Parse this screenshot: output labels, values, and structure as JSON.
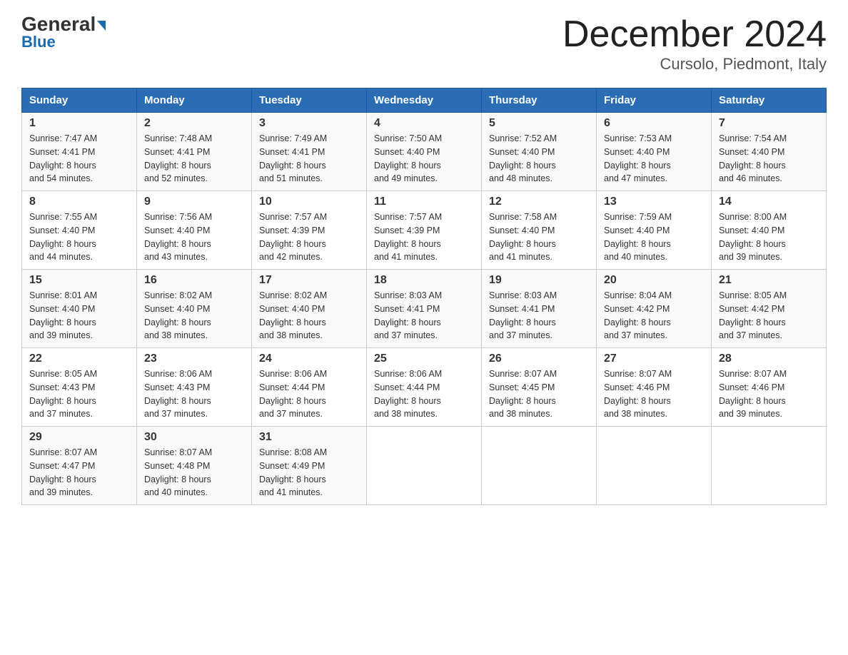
{
  "header": {
    "logo_general": "General",
    "logo_blue": "Blue",
    "title": "December 2024",
    "subtitle": "Cursolo, Piedmont, Italy"
  },
  "days_of_week": [
    "Sunday",
    "Monday",
    "Tuesday",
    "Wednesday",
    "Thursday",
    "Friday",
    "Saturday"
  ],
  "weeks": [
    [
      {
        "day": "1",
        "info": "Sunrise: 7:47 AM\nSunset: 4:41 PM\nDaylight: 8 hours\nand 54 minutes."
      },
      {
        "day": "2",
        "info": "Sunrise: 7:48 AM\nSunset: 4:41 PM\nDaylight: 8 hours\nand 52 minutes."
      },
      {
        "day": "3",
        "info": "Sunrise: 7:49 AM\nSunset: 4:41 PM\nDaylight: 8 hours\nand 51 minutes."
      },
      {
        "day": "4",
        "info": "Sunrise: 7:50 AM\nSunset: 4:40 PM\nDaylight: 8 hours\nand 49 minutes."
      },
      {
        "day": "5",
        "info": "Sunrise: 7:52 AM\nSunset: 4:40 PM\nDaylight: 8 hours\nand 48 minutes."
      },
      {
        "day": "6",
        "info": "Sunrise: 7:53 AM\nSunset: 4:40 PM\nDaylight: 8 hours\nand 47 minutes."
      },
      {
        "day": "7",
        "info": "Sunrise: 7:54 AM\nSunset: 4:40 PM\nDaylight: 8 hours\nand 46 minutes."
      }
    ],
    [
      {
        "day": "8",
        "info": "Sunrise: 7:55 AM\nSunset: 4:40 PM\nDaylight: 8 hours\nand 44 minutes."
      },
      {
        "day": "9",
        "info": "Sunrise: 7:56 AM\nSunset: 4:40 PM\nDaylight: 8 hours\nand 43 minutes."
      },
      {
        "day": "10",
        "info": "Sunrise: 7:57 AM\nSunset: 4:39 PM\nDaylight: 8 hours\nand 42 minutes."
      },
      {
        "day": "11",
        "info": "Sunrise: 7:57 AM\nSunset: 4:39 PM\nDaylight: 8 hours\nand 41 minutes."
      },
      {
        "day": "12",
        "info": "Sunrise: 7:58 AM\nSunset: 4:40 PM\nDaylight: 8 hours\nand 41 minutes."
      },
      {
        "day": "13",
        "info": "Sunrise: 7:59 AM\nSunset: 4:40 PM\nDaylight: 8 hours\nand 40 minutes."
      },
      {
        "day": "14",
        "info": "Sunrise: 8:00 AM\nSunset: 4:40 PM\nDaylight: 8 hours\nand 39 minutes."
      }
    ],
    [
      {
        "day": "15",
        "info": "Sunrise: 8:01 AM\nSunset: 4:40 PM\nDaylight: 8 hours\nand 39 minutes."
      },
      {
        "day": "16",
        "info": "Sunrise: 8:02 AM\nSunset: 4:40 PM\nDaylight: 8 hours\nand 38 minutes."
      },
      {
        "day": "17",
        "info": "Sunrise: 8:02 AM\nSunset: 4:40 PM\nDaylight: 8 hours\nand 38 minutes."
      },
      {
        "day": "18",
        "info": "Sunrise: 8:03 AM\nSunset: 4:41 PM\nDaylight: 8 hours\nand 37 minutes."
      },
      {
        "day": "19",
        "info": "Sunrise: 8:03 AM\nSunset: 4:41 PM\nDaylight: 8 hours\nand 37 minutes."
      },
      {
        "day": "20",
        "info": "Sunrise: 8:04 AM\nSunset: 4:42 PM\nDaylight: 8 hours\nand 37 minutes."
      },
      {
        "day": "21",
        "info": "Sunrise: 8:05 AM\nSunset: 4:42 PM\nDaylight: 8 hours\nand 37 minutes."
      }
    ],
    [
      {
        "day": "22",
        "info": "Sunrise: 8:05 AM\nSunset: 4:43 PM\nDaylight: 8 hours\nand 37 minutes."
      },
      {
        "day": "23",
        "info": "Sunrise: 8:06 AM\nSunset: 4:43 PM\nDaylight: 8 hours\nand 37 minutes."
      },
      {
        "day": "24",
        "info": "Sunrise: 8:06 AM\nSunset: 4:44 PM\nDaylight: 8 hours\nand 37 minutes."
      },
      {
        "day": "25",
        "info": "Sunrise: 8:06 AM\nSunset: 4:44 PM\nDaylight: 8 hours\nand 38 minutes."
      },
      {
        "day": "26",
        "info": "Sunrise: 8:07 AM\nSunset: 4:45 PM\nDaylight: 8 hours\nand 38 minutes."
      },
      {
        "day": "27",
        "info": "Sunrise: 8:07 AM\nSunset: 4:46 PM\nDaylight: 8 hours\nand 38 minutes."
      },
      {
        "day": "28",
        "info": "Sunrise: 8:07 AM\nSunset: 4:46 PM\nDaylight: 8 hours\nand 39 minutes."
      }
    ],
    [
      {
        "day": "29",
        "info": "Sunrise: 8:07 AM\nSunset: 4:47 PM\nDaylight: 8 hours\nand 39 minutes."
      },
      {
        "day": "30",
        "info": "Sunrise: 8:07 AM\nSunset: 4:48 PM\nDaylight: 8 hours\nand 40 minutes."
      },
      {
        "day": "31",
        "info": "Sunrise: 8:08 AM\nSunset: 4:49 PM\nDaylight: 8 hours\nand 41 minutes."
      },
      null,
      null,
      null,
      null
    ]
  ]
}
